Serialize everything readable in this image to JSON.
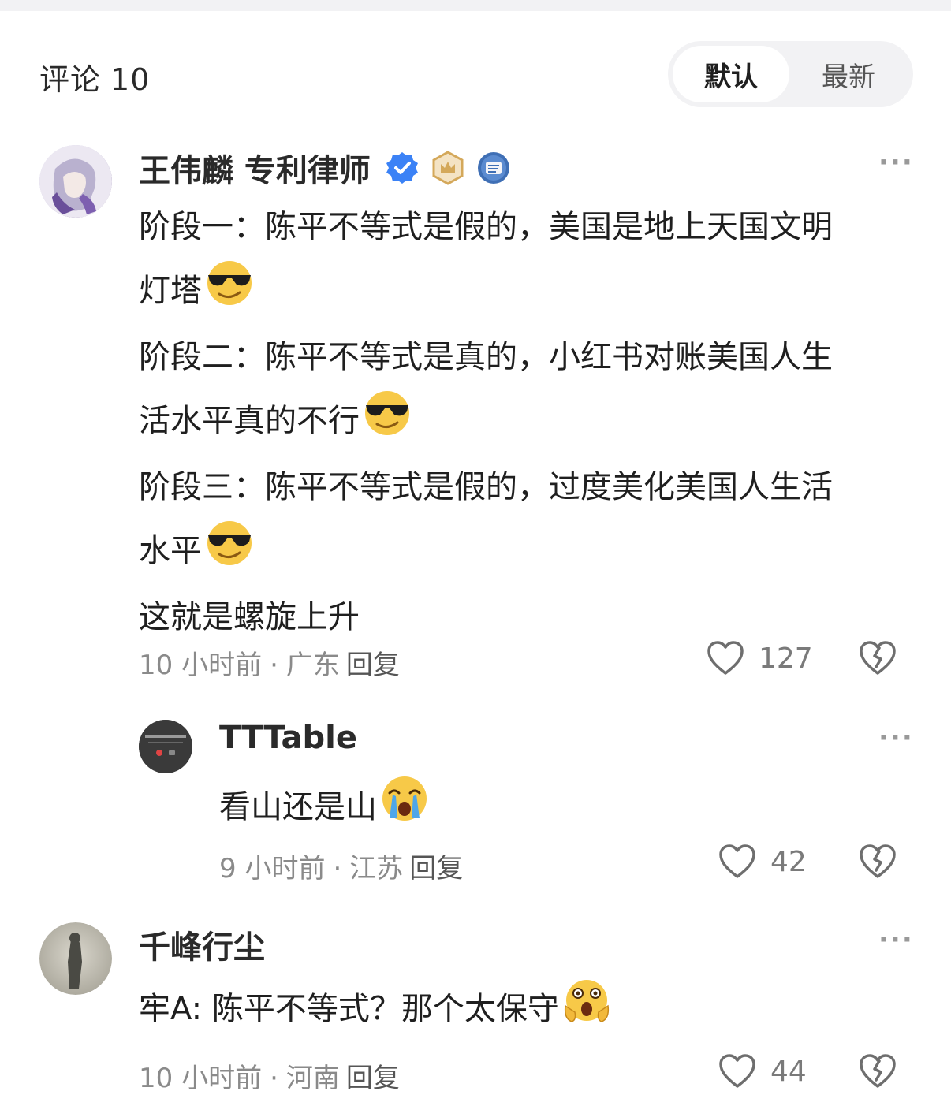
{
  "header": {
    "title": "评论",
    "count": "10",
    "sort_default": "默认",
    "sort_latest": "最新"
  },
  "comments": [
    {
      "author": "王伟麟 专利律师",
      "lines": [
        "阶段一：陈平不等式是假的，美国是地上天国文明",
        "灯塔",
        "阶段二：陈平不等式是真的，小红书对账美国人生",
        "活水平真的不行",
        "阶段三：陈平不等式是假的，过度美化美国人生活",
        "水平",
        "这就是螺旋上升"
      ],
      "time": "10 小时前",
      "region": "广东",
      "reply": "回复",
      "likes": "127",
      "emoji": "sunglasses-emoji"
    },
    {
      "author": "TTTable",
      "text": "看山还是山",
      "time": "9 小时前",
      "region": "江苏",
      "reply": "回复",
      "likes": "42",
      "emoji": "crying-emoji"
    },
    {
      "author": "千峰行尘",
      "text": "牢A: 陈平不等式？那个太保守",
      "time": "10 小时前",
      "region": "河南",
      "reply": "回复",
      "likes": "44",
      "emoji": "scared-emoji"
    }
  ],
  "more_label": "···",
  "colors": {
    "verified": "#3b82f6",
    "badge_gold": "#d4a85a",
    "badge_blue": "#3f6fb5",
    "emoji_yellow": "#f7c948"
  }
}
